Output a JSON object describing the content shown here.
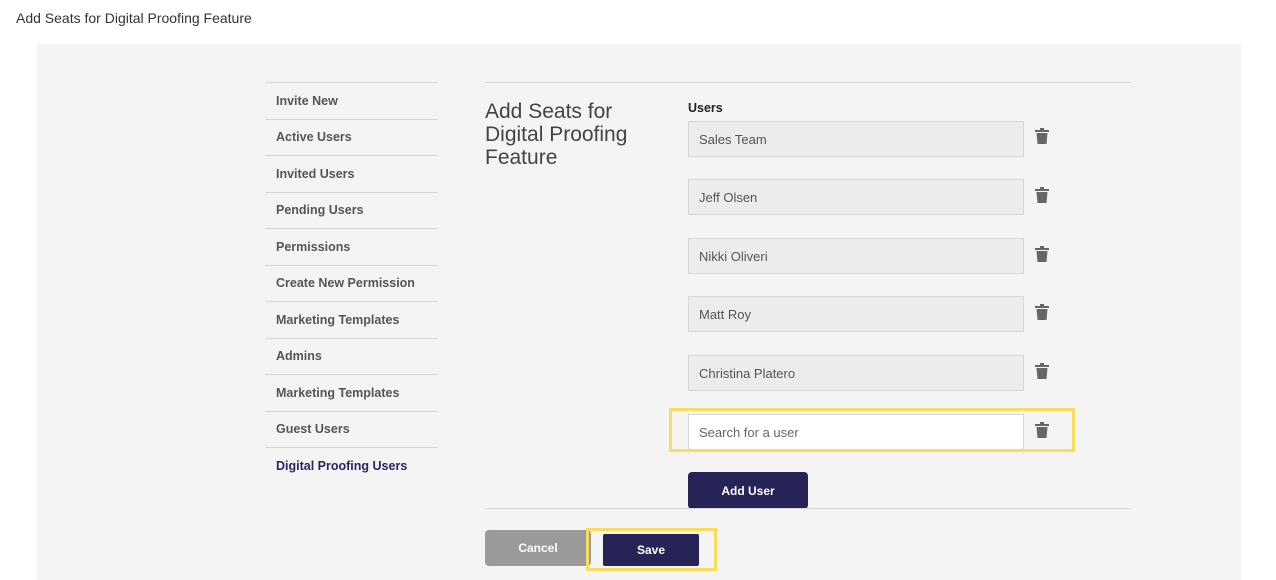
{
  "header": {
    "title": "Add Seats for Digital Proofing Feature"
  },
  "sidebar": {
    "items": [
      {
        "label": "Invite New"
      },
      {
        "label": "Active Users"
      },
      {
        "label": "Invited Users"
      },
      {
        "label": "Pending Users"
      },
      {
        "label": "Permissions"
      },
      {
        "label": "Create New Permission"
      },
      {
        "label": "Marketing Templates"
      },
      {
        "label": "Admins"
      },
      {
        "label": "Marketing Templates"
      },
      {
        "label": "Guest Users"
      },
      {
        "label": "Digital Proofing Users",
        "active": true
      }
    ]
  },
  "main": {
    "section_title": "Add Seats for Digital Proofing Feature",
    "users_label": "Users",
    "users": [
      {
        "value": "Sales Team"
      },
      {
        "value": "Jeff Olsen"
      },
      {
        "value": "Nikki Oliveri"
      },
      {
        "value": "Matt Roy"
      },
      {
        "value": "Christina Platero"
      }
    ],
    "search": {
      "placeholder": "Search for a user",
      "value": ""
    },
    "add_user_label": "Add User",
    "cancel_label": "Cancel",
    "save_label": "Save"
  },
  "icons": {
    "delete": "trash-icon"
  },
  "colors": {
    "primary": "#262356",
    "highlight": "#f8dc5b",
    "cancel": "#9a9a9a",
    "panel": "#f4f4f4"
  }
}
